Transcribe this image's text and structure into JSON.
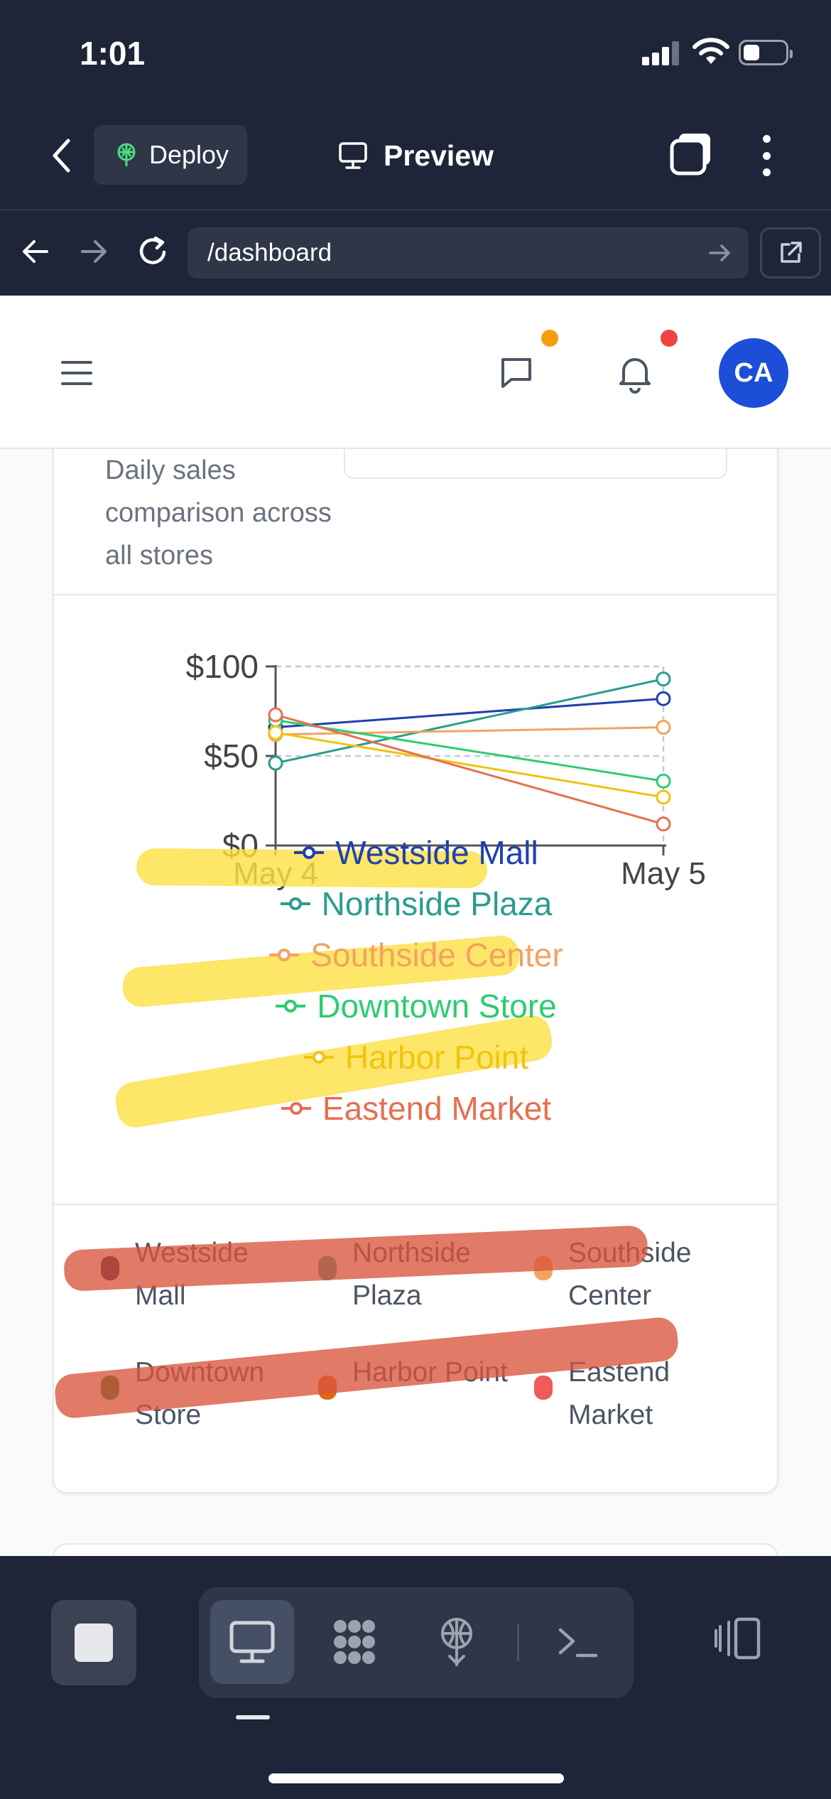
{
  "status_bar": {
    "time": "1:01"
  },
  "app_header": {
    "deploy_label": "Deploy",
    "title": "Preview"
  },
  "browser": {
    "url": "/dashboard"
  },
  "page_header": {
    "avatar_initials": "CA",
    "chat_badge_color": "#f59e0b",
    "bell_badge_color": "#ef4444"
  },
  "card": {
    "description": "Daily sales comparison across all stores",
    "range_select_value": ""
  },
  "chart_data": {
    "type": "line",
    "x": [
      "May 4",
      "May 5"
    ],
    "y_ticks": [
      "$0",
      "$50",
      "$100"
    ],
    "ylim": [
      0,
      100
    ],
    "grid": true,
    "legend_position": "bottom",
    "series": [
      {
        "name": "Westside Mall",
        "color": "#1e40af",
        "values": [
          66,
          82
        ]
      },
      {
        "name": "Northside Plaza",
        "color": "#2a9d8f",
        "values": [
          46,
          93
        ]
      },
      {
        "name": "Southside Center",
        "color": "#f4a261",
        "values": [
          62,
          66
        ]
      },
      {
        "name": "Downtown Store",
        "color": "#2ecc71",
        "values": [
          70,
          36
        ]
      },
      {
        "name": "Harbor Point",
        "color": "#f1c40f",
        "values": [
          63,
          27
        ]
      },
      {
        "name": "Eastend Market",
        "color": "#e76f51",
        "values": [
          73,
          12
        ]
      }
    ]
  },
  "store_legend": [
    {
      "label": "Westside Mall",
      "color": "#111a3e"
    },
    {
      "label": "Northside Plaza",
      "color": "#2a9d8f"
    },
    {
      "label": "Southside Center",
      "color": "#f4a261"
    },
    {
      "label": "Downtown Store",
      "color": "#1f7a2c"
    },
    {
      "label": "Harbor Point",
      "color": "#e2680f"
    },
    {
      "label": "Eastend Market",
      "color": "#f05a5a"
    }
  ],
  "annotations": {
    "yellow_marker": "#fde047",
    "red_marker": "#d9543c"
  },
  "toolbar": {
    "tools": [
      "desktop-icon",
      "apps-grid-icon",
      "deploy-icon",
      "terminal-icon"
    ],
    "active_tool": "desktop-icon"
  }
}
